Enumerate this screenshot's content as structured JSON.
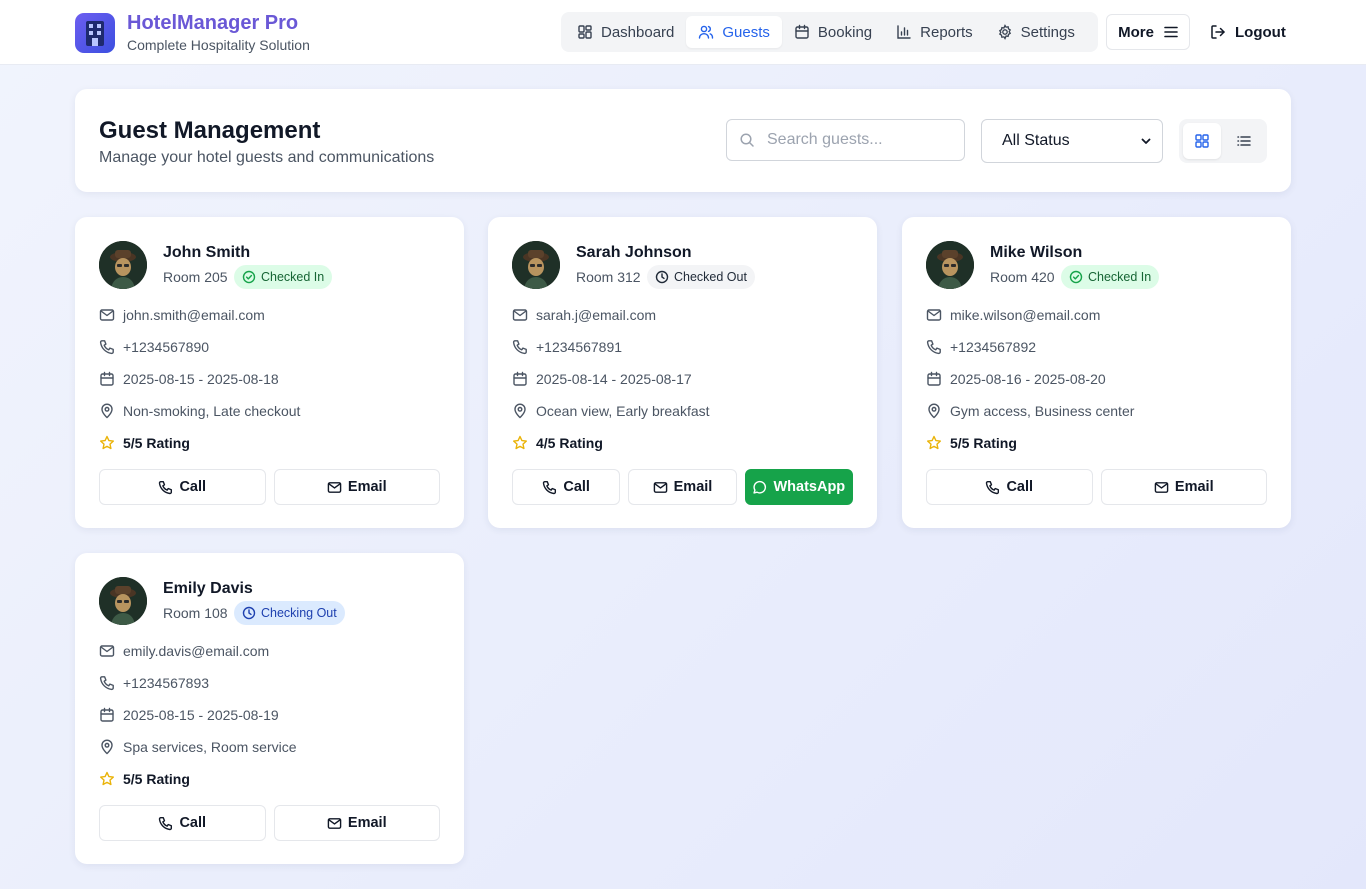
{
  "app": {
    "title": "HotelManager Pro",
    "subtitle": "Complete Hospitality Solution"
  },
  "nav": {
    "items": [
      {
        "label": "Dashboard",
        "icon": "grid-icon",
        "active": false
      },
      {
        "label": "Guests",
        "icon": "users-icon",
        "active": true
      },
      {
        "label": "Booking",
        "icon": "calendar-icon",
        "active": false
      },
      {
        "label": "Reports",
        "icon": "bar-chart-icon",
        "active": false
      },
      {
        "label": "Settings",
        "icon": "gear-icon",
        "active": false
      }
    ],
    "more_label": "More",
    "logout_label": "Logout"
  },
  "page": {
    "title": "Guest Management",
    "subtitle": "Manage your hotel guests and communications",
    "search_placeholder": "Search guests...",
    "status_filter": "All Status"
  },
  "colors": {
    "accent": "#2563eb",
    "brand": "#6a58d6",
    "checked_in": "#166534",
    "checking_out": "#1e40af",
    "whatsapp": "#16a34a",
    "star": "#eab308"
  },
  "guests": [
    {
      "name": "John Smith",
      "room": "Room 205",
      "status": "Checked In",
      "status_type": "in",
      "email": "john.smith@email.com",
      "phone": "+1234567890",
      "dates": "2025-08-15 - 2025-08-18",
      "preferences": "Non-smoking, Late checkout",
      "rating": "5/5 Rating",
      "actions": {
        "call": "Call",
        "email": "Email"
      }
    },
    {
      "name": "Sarah Johnson",
      "room": "Room 312",
      "status": "Checked Out",
      "status_type": "out",
      "email": "sarah.j@email.com",
      "phone": "+1234567891",
      "dates": "2025-08-14 - 2025-08-17",
      "preferences": "Ocean view, Early breakfast",
      "rating": "4/5 Rating",
      "actions": {
        "call": "Call",
        "email": "Email",
        "whatsapp": "WhatsApp"
      }
    },
    {
      "name": "Mike Wilson",
      "room": "Room 420",
      "status": "Checked In",
      "status_type": "in",
      "email": "mike.wilson@email.com",
      "phone": "+1234567892",
      "dates": "2025-08-16 - 2025-08-20",
      "preferences": "Gym access, Business center",
      "rating": "5/5 Rating",
      "actions": {
        "call": "Call",
        "email": "Email"
      }
    },
    {
      "name": "Emily Davis",
      "room": "Room 108",
      "status": "Checking Out",
      "status_type": "checking",
      "email": "emily.davis@email.com",
      "phone": "+1234567893",
      "dates": "2025-08-15 - 2025-08-19",
      "preferences": "Spa services, Room service",
      "rating": "5/5 Rating",
      "actions": {
        "call": "Call",
        "email": "Email"
      }
    }
  ]
}
